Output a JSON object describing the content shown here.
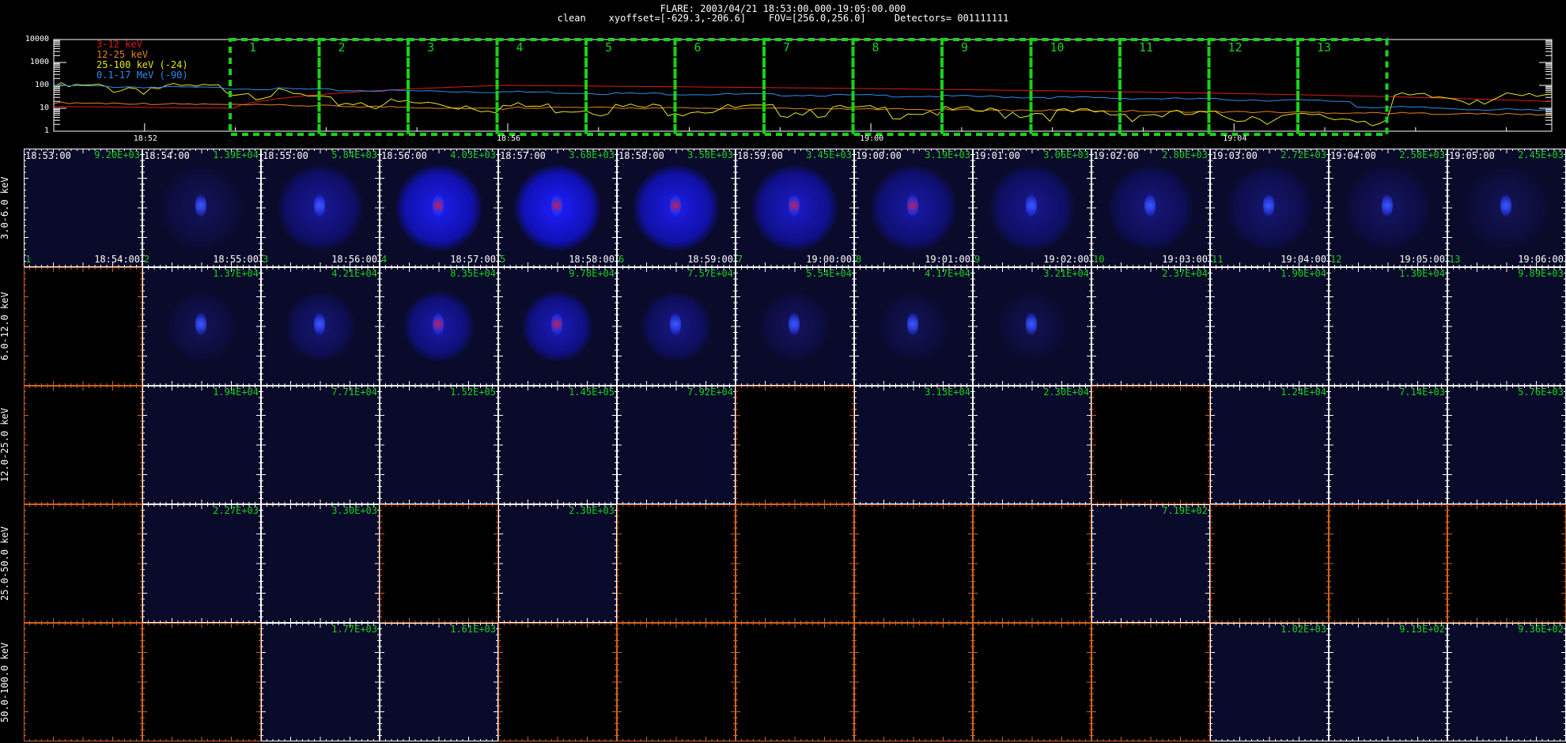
{
  "header": {
    "line1": "FLARE: 2003/04/21 18:53:00.000-19:05:00.000",
    "line2": "clean    xyoffset=[-629.3,-206.6]    FOV=[256.0,256.0]     Detectors= 001111111"
  },
  "colors": {
    "green": "#19d219",
    "red": "#e01a1a",
    "orange": "#e8821e",
    "yellow": "#e6e61e",
    "blue": "#2d8cf0",
    "white": "#ffffff",
    "axis_orange": "#d2641e",
    "image_bg": "#0a0a2a"
  },
  "chart_data": {
    "type": "line",
    "title": "",
    "ylog": true,
    "ylim": [
      1,
      10000
    ],
    "y_tick_labels": [
      "10000",
      "1000",
      "100",
      "10",
      "1"
    ],
    "x_tick_labels": [
      "18:52",
      "18:56",
      "19:00",
      "19:04"
    ],
    "series": [
      {
        "name": "3-12 keV",
        "color": "#e01a1a"
      },
      {
        "name": "12-25 keV",
        "color": "#e8821e"
      },
      {
        "name": "25-100 keV (-24)",
        "color": "#e6e61e"
      },
      {
        "name": "0.1-17 MeV (-90)",
        "color": "#2d8cf0"
      }
    ],
    "interval_boxes": [
      "1",
      "2",
      "3",
      "4",
      "5",
      "6",
      "7",
      "8",
      "9",
      "10",
      "11",
      "12",
      "13"
    ]
  },
  "image_grid": {
    "bands": [
      "3.0-6.0 keV",
      "6.0-12.0 keV",
      "12.0-25.0 keV",
      "25.0-50.0 keV",
      "50.0-100.0 keV"
    ],
    "start_times": [
      "18:53:00",
      "18:54:00",
      "18:55:00",
      "18:56:00",
      "18:57:00",
      "18:58:00",
      "18:59:00",
      "19:00:00",
      "19:01:00",
      "19:02:00",
      "19:03:00",
      "19:04:00",
      "19:05:00"
    ],
    "end_times": [
      "18:54:00",
      "18:55:00",
      "18:56:00",
      "18:57:00",
      "18:58:00",
      "18:59:00",
      "19:00:00",
      "19:01:00",
      "19:02:00",
      "19:03:00",
      "19:04:00",
      "19:05:00",
      "19:06:00"
    ],
    "indices": [
      "1",
      "2",
      "3",
      "4",
      "5",
      "6",
      "7",
      "8",
      "9",
      "10",
      "11",
      "12",
      "13"
    ],
    "max_values": [
      [
        "9.20E+03",
        "1.39E+04",
        "5.84E+03",
        "4.03E+03",
        "3.68E+03",
        "3.58E+03",
        "3.45E+03",
        "3.19E+03",
        "3.06E+03",
        "2.80E+03",
        "2.72E+03",
        "2.58E+03",
        "2.45E+03"
      ],
      [
        "",
        "1.37E+04",
        "4.21E+04",
        "8.35E+04",
        "9.78E+04",
        "7.57E+04",
        "5.54E+04",
        "4.17E+04",
        "3.21E+04",
        "2.37E+04",
        "1.90E+04",
        "1.30E+04",
        "9.89E+03"
      ],
      [
        "",
        "1.94E+04",
        "7.71E+04",
        "1.52E+05",
        "1.45E+05",
        "7.92E+04",
        "",
        "3.13E+04",
        "2.30E+04",
        "",
        "1.24E+04",
        "7.14E+03",
        "5.76E+03"
      ],
      [
        "",
        "2.27E+03",
        "3.30E+03",
        "",
        "2.30E+03",
        "",
        "",
        "",
        "",
        "7.19E+02",
        "",
        "",
        ""
      ],
      [
        "",
        "",
        "1.77E+03",
        "1.61E+03",
        "",
        "",
        "",
        "",
        "",
        "",
        "1.02E+03",
        "9.13E+02",
        "9.36E+02"
      ]
    ]
  }
}
